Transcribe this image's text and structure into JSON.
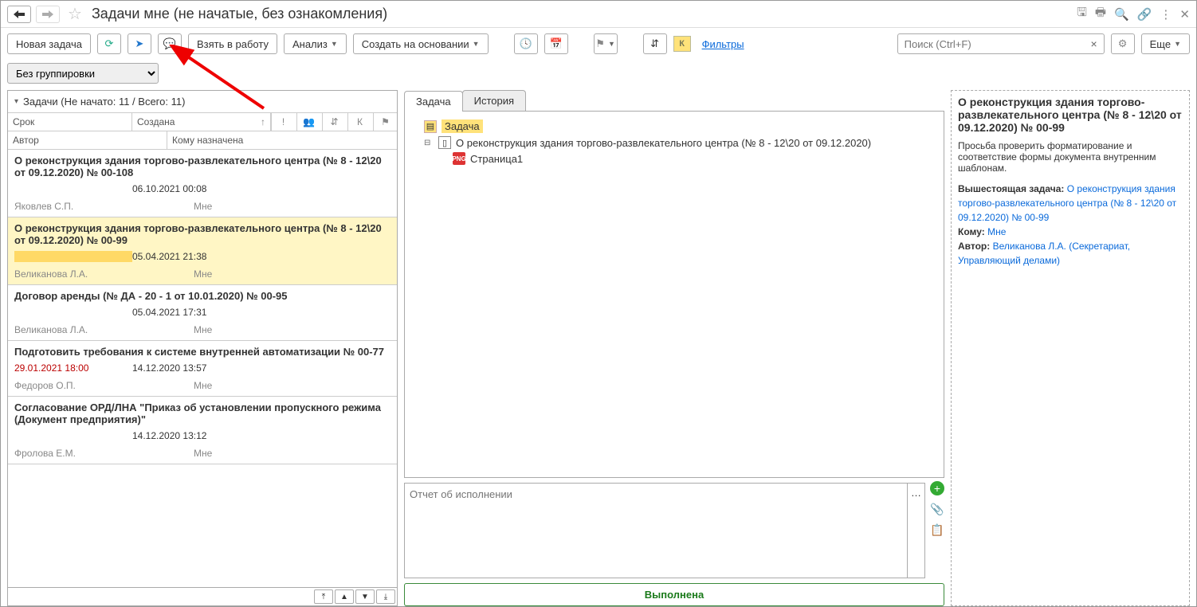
{
  "header": {
    "title": "Задачи мне (не начатые, без ознакомления)"
  },
  "toolbar": {
    "new_task": "Новая задача",
    "take_work": "Взять в работу",
    "analysis": "Анализ",
    "create_based": "Создать на основании",
    "filters": "Фильтры",
    "k_label": "К",
    "more": "Еще",
    "search_placeholder": "Поиск (Ctrl+F)"
  },
  "grouping": {
    "selected": "Без группировки"
  },
  "list": {
    "title": "Задачи (Не начато: 11 / Всего: 11)",
    "col_srok": "Срок",
    "col_sozdana": "Создана",
    "col_author": "Автор",
    "col_komu": "Кому назначена",
    "col_k": "К"
  },
  "tasks": [
    {
      "title": "О реконструкция здания торгово-развлекательного центра (№ 8 - 12\\20 от 09.12.2020) № 00-108",
      "srok": "",
      "sozdana": "06.10.2021 00:08",
      "author": "Яковлев С.П.",
      "komu": "Мне",
      "selected": false,
      "overdue": false
    },
    {
      "title": "О реконструкция здания торгово-развлекательного центра (№ 8 - 12\\20 от 09.12.2020) № 00-99",
      "srok": "",
      "sozdana": "05.04.2021 21:38",
      "author": "Великанова Л.А.",
      "komu": "Мне",
      "selected": true,
      "overdue": false
    },
    {
      "title": "Договор аренды (№ ДА - 20 - 1 от 10.01.2020) № 00-95",
      "srok": "",
      "sozdana": "05.04.2021 17:31",
      "author": "Великанова Л.А.",
      "komu": "Мне",
      "selected": false,
      "overdue": false
    },
    {
      "title": "Подготовить требования к системе внутренней автоматизации № 00-77",
      "srok": "29.01.2021 18:00",
      "sozdana": "14.12.2020 13:57",
      "author": "Федоров О.П.",
      "komu": "Мне",
      "selected": false,
      "overdue": true
    },
    {
      "title": "Согласование ОРД/ЛНА \"Приказ об установлении пропускного режима (Документ предприятия)\"",
      "srok": "",
      "sozdana": "14.12.2020 13:12",
      "author": "Фролова Е.М.",
      "komu": "Мне",
      "selected": false,
      "overdue": false
    }
  ],
  "tabs": {
    "task": "Задача",
    "history": "История"
  },
  "tree": {
    "root": "Задача",
    "doc": "О реконструкция здания торгово-развлекательного центра (№ 8 - 12\\20 от 09.12.2020)",
    "page": "Страница1",
    "png_label": "PNG"
  },
  "report": {
    "placeholder": "Отчет об исполнении"
  },
  "done_button": "Выполнена",
  "details": {
    "title": "О реконструкция здания торгово-развлекательного центра (№ 8 - 12\\20 от 09.12.2020) № 00-99",
    "description": "Просьба проверить форматирование и соответствие формы документа внутренним шаблонам.",
    "parent_label": "Вышестоящая задача:",
    "parent_link": "О реконструкция здания торгово-развлекательного центра (№ 8 - 12\\20 от 09.12.2020) № 00-99",
    "komu_label": "Кому:",
    "komu_link": "Мне",
    "author_label": "Автор:",
    "author_link": "Великанова Л.А. (Секретариат, Управляющий делами)"
  }
}
